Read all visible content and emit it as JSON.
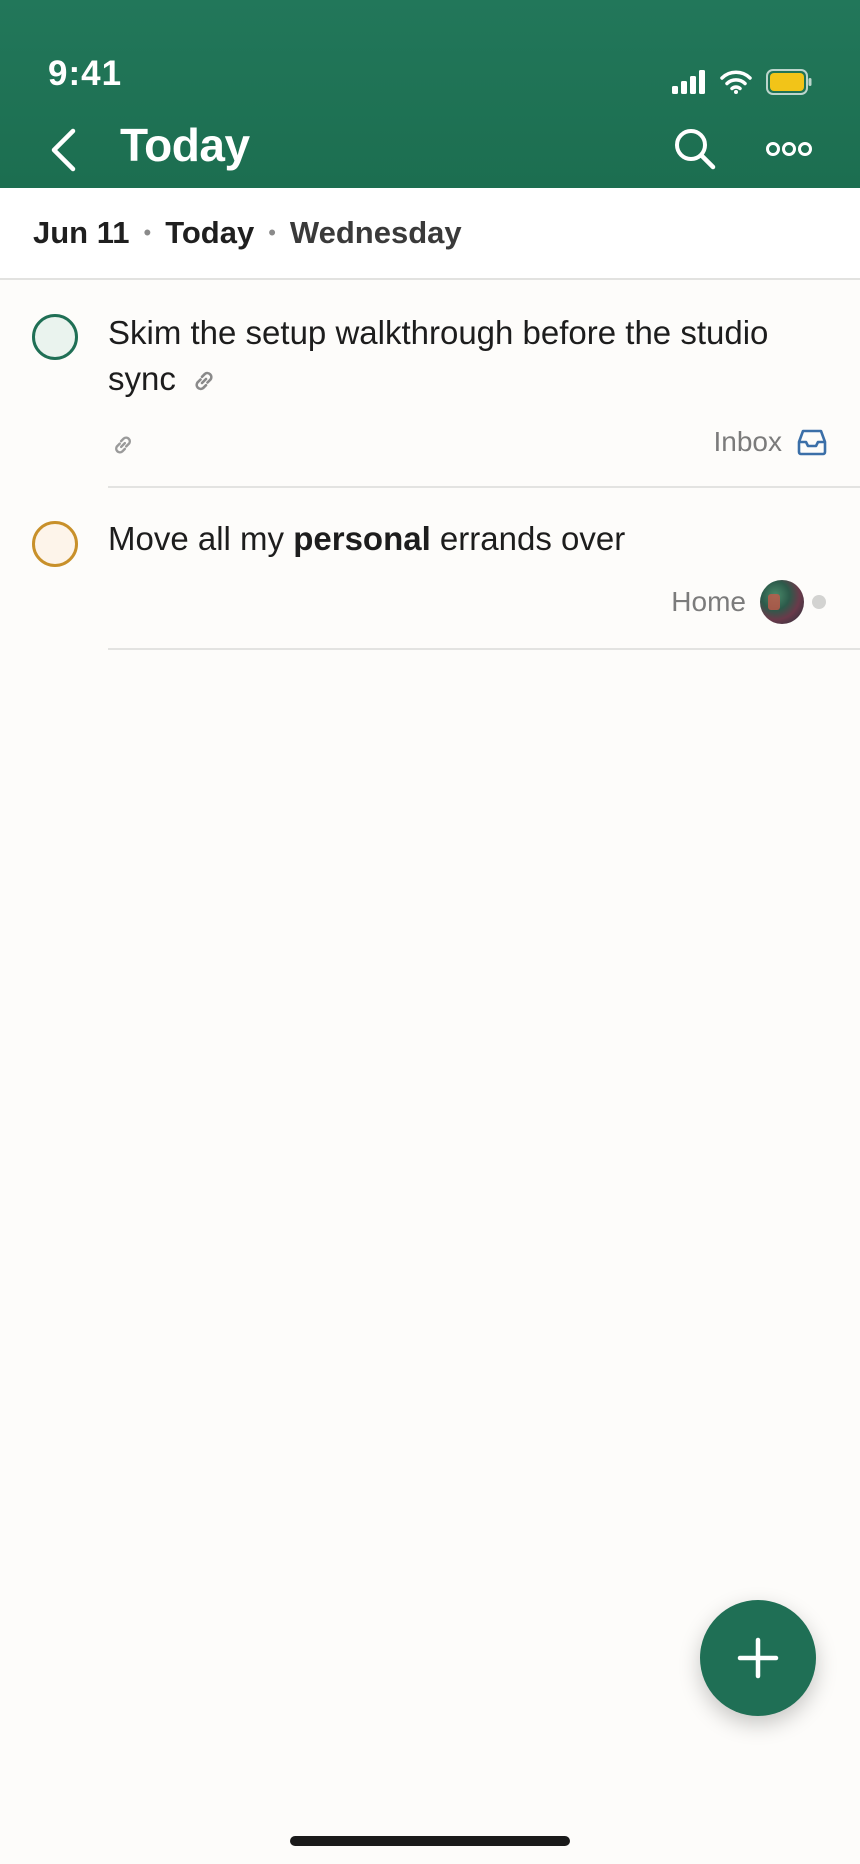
{
  "status_bar": {
    "time": "9:41"
  },
  "nav": {
    "title": "Today",
    "back_icon": "chevron-left-icon",
    "search_icon": "search-icon",
    "more_icon": "more-horizontal-icon"
  },
  "date_strip": {
    "date": "Jun 11",
    "relative": "Today",
    "weekday": "Wednesday"
  },
  "tasks": [
    {
      "title": "Skim the setup walkthrough before the studio sync",
      "has_link": true,
      "project": "Inbox",
      "project_icon": "inbox-icon",
      "check_color": "#1f6f55"
    },
    {
      "title_parts": [
        "Move all my ",
        "personal",
        " errands over"
      ],
      "project": "Home",
      "has_avatar": true,
      "check_color": "#c8902a"
    }
  ],
  "colors": {
    "header": "#1f6f55",
    "accent_green": "#1f6f55",
    "accent_amber": "#c8902a",
    "inbox_blue": "#3b6fa8"
  }
}
